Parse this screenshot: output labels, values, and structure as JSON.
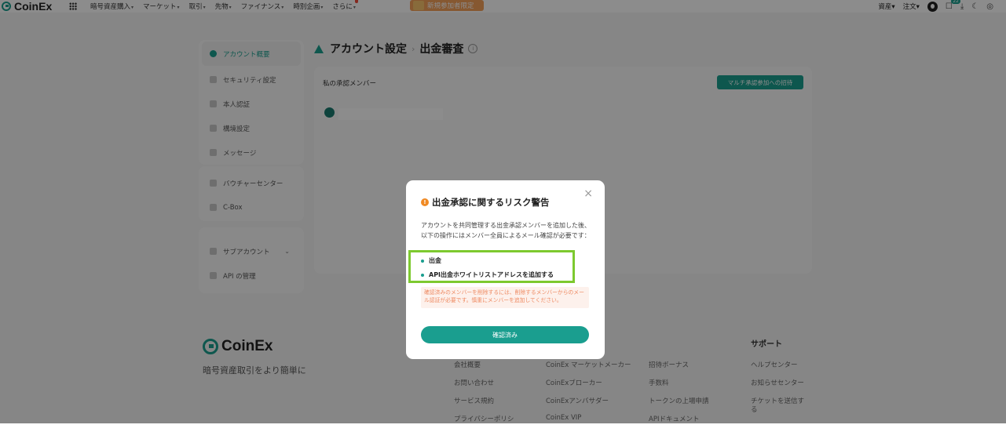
{
  "topbar": {
    "brand": "CoinEx",
    "nav": [
      {
        "label": "暗号資産購入",
        "caret": "▾"
      },
      {
        "label": "マーケット",
        "caret": "▾"
      },
      {
        "label": "取引",
        "caret": "▾"
      },
      {
        "label": "先物",
        "caret": "▾"
      },
      {
        "label": "ファイナンス",
        "caret": "▾"
      },
      {
        "label": "時別企画",
        "caret": "▾"
      },
      {
        "label": "さらに",
        "caret": "▾"
      }
    ],
    "promo": "新規参加者限定",
    "right": {
      "assets": "資産▾",
      "orders": "注文▾",
      "notification_count": "22"
    }
  },
  "sidebar": {
    "group1": [
      {
        "label": "アカウント概要",
        "active": true
      },
      {
        "label": "セキュリティ設定"
      },
      {
        "label": "本人認証"
      },
      {
        "label": "構境設定"
      },
      {
        "label": "メッセージ"
      }
    ],
    "group2": [
      {
        "label": "バウチャーセンター"
      },
      {
        "label": "C-Box"
      }
    ],
    "group3": [
      {
        "label": "サブアカウント",
        "caret": "⌄"
      },
      {
        "label": "API の管理"
      }
    ]
  },
  "breadcrumb": {
    "parent": "アカウント設定",
    "separator": "›",
    "current": "出金審査"
  },
  "panel": {
    "title": "私の承認メンバー",
    "invite_button": "マルチ承認参加への招待"
  },
  "footer": {
    "brand": "CoinEx",
    "tagline": "暗号資産取引をより簡単に",
    "col1": [
      "会社概要",
      "お問い合わせ",
      "サービス規約",
      "プライバシーポリシ"
    ],
    "col2": [
      "CoinEx マーケットメーカー",
      "CoinExブローカー",
      "CoinExアンバサダー",
      "CoinEx VIP"
    ],
    "col3": [
      "招待ボーナス",
      "手数料",
      "トークンの上場申請",
      "APIドキュメント"
    ],
    "support_head": "サポート",
    "col4": [
      "ヘルプセンター",
      "お知らせセンター",
      "チケットを送信す",
      "る"
    ]
  },
  "modal": {
    "title": "出金承認に関するリスク警告",
    "body": "アカウントを共同管理する出金承認メンバーを追加した後、以下の操作にはメンバー全員によるメール確認が必要です：",
    "bullets": [
      "出金",
      "API出金ホワイトリストアドレスを追加する"
    ],
    "note": "確認済みのメンバーを削除するには、削除するメンバーからのメール認証が必要です。慎重にメンバーを追加してください。",
    "confirm": "確認済み",
    "close": "×"
  },
  "colors": {
    "accent": "#1a9e8f",
    "warning": "#f08a24",
    "highlight": "#7dc92f"
  }
}
